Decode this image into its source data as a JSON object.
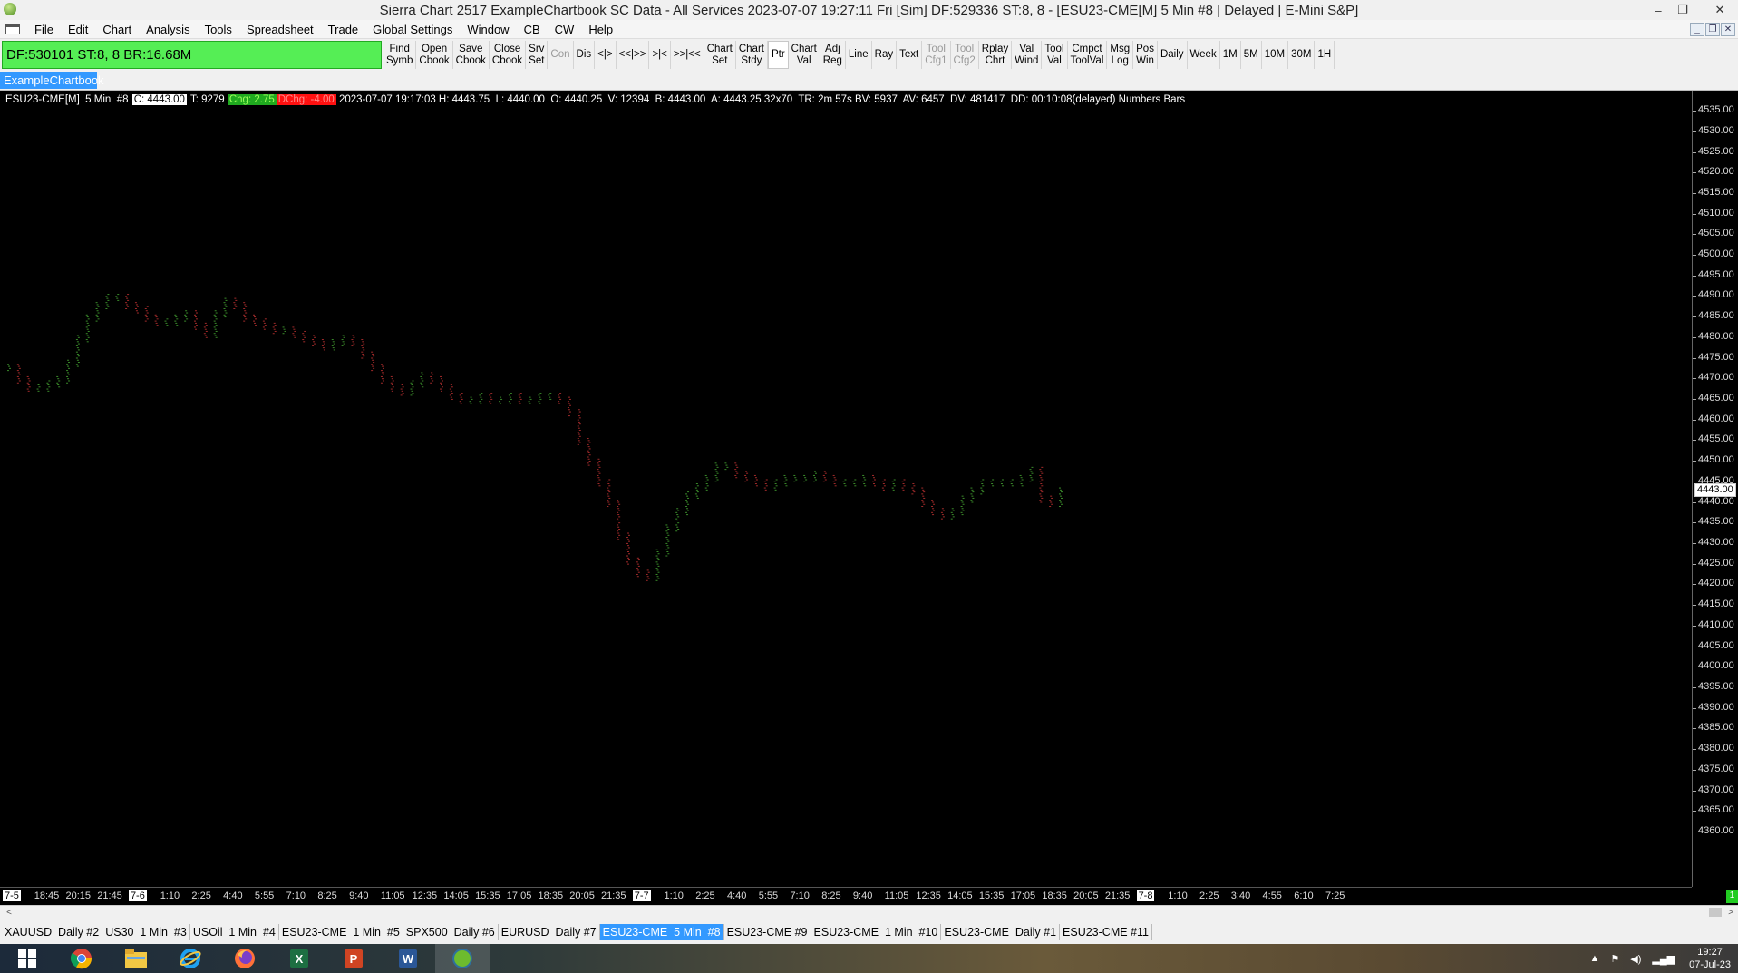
{
  "window": {
    "title": "Sierra Chart 2517 ExampleChartbook SC Data - All Services 2023-07-07  19:27:11 Fri [Sim]  DF:529336  ST:8, 8 - [ESU23-CME[M]  5 Min  #8 | Delayed | E-Mini S&P]",
    "minimize": "–",
    "restore": "❐",
    "close": "✕"
  },
  "menu": [
    "File",
    "Edit",
    "Chart",
    "Analysis",
    "Tools",
    "Spreadsheet",
    "Trade",
    "Global Settings",
    "Window",
    "CB",
    "CW",
    "Help"
  ],
  "mdi_controls": [
    "_",
    "❐",
    "✕"
  ],
  "toolbar": {
    "status": "DF:530101  ST:8, 8  BR:16.68M",
    "buttons": [
      {
        "label": "Find\nSymb",
        "disabled": false
      },
      {
        "label": "Open\nCbook",
        "disabled": false
      },
      {
        "label": "Save\nCbook",
        "disabled": false
      },
      {
        "label": "Close\nCbook",
        "disabled": false
      },
      {
        "label": "Srv\nSet",
        "disabled": false
      },
      {
        "label": "Con",
        "disabled": true
      },
      {
        "label": "Dis",
        "disabled": false
      },
      {
        "label": "<|>",
        "disabled": false
      },
      {
        "label": "<<|>>",
        "disabled": false
      },
      {
        "label": ">|<",
        "disabled": false
      },
      {
        "label": ">>|<<",
        "disabled": false
      },
      {
        "label": "Chart\nSet",
        "disabled": false
      },
      {
        "label": "Chart\nStdy",
        "disabled": false
      },
      {
        "label": "Ptr",
        "disabled": false,
        "active": true
      },
      {
        "label": "Chart\nVal",
        "disabled": false
      },
      {
        "label": "Adj\nReg",
        "disabled": false
      },
      {
        "label": "Line",
        "disabled": false
      },
      {
        "label": "Ray",
        "disabled": false
      },
      {
        "label": "Text",
        "disabled": false
      },
      {
        "label": "Tool\nCfg1",
        "disabled": true
      },
      {
        "label": "Tool\nCfg2",
        "disabled": true
      },
      {
        "label": "Rplay\nChrt",
        "disabled": false
      },
      {
        "label": "Val\nWind",
        "disabled": false
      },
      {
        "label": "Tool\nVal",
        "disabled": false
      },
      {
        "label": "Cmpct\nToolVal",
        "disabled": false
      },
      {
        "label": "Msg\nLog",
        "disabled": false
      },
      {
        "label": "Pos\nWin",
        "disabled": false
      },
      {
        "label": "Daily",
        "disabled": false
      },
      {
        "label": "Week",
        "disabled": false
      },
      {
        "label": "1M",
        "disabled": false
      },
      {
        "label": "5M",
        "disabled": false
      },
      {
        "label": "10M",
        "disabled": false
      },
      {
        "label": "30M",
        "disabled": false
      },
      {
        "label": "1H",
        "disabled": false
      }
    ]
  },
  "chartbook_tab": "ExampleChartbook",
  "chart_header": {
    "symbol": "ESU23-CME[M]  5 Min  #8 ",
    "close": "C: 4443.00",
    "trades": " T: 9279 ",
    "chg": "Chg: 2.75",
    "dchg": "DChg: -4.00",
    "rest": " 2023-07-07 19:17:03 H: 4443.75  L: 4440.00  O: 4440.25  V: 12394  B: 4443.00  A: 4443.25 32x70  TR: 2m 57s BV: 5937  AV: 6457  DV: 481417  DD: 00:10:08(delayed) Numbers Bars"
  },
  "chart_data": {
    "type": "scatter",
    "title": "ESU23-CME[M] 5 Min #8",
    "ylim": [
      4360.0,
      4537.0
    ],
    "y_ticks": [
      "4535.00",
      "4530.00",
      "4525.00",
      "4520.00",
      "4515.00",
      "4510.00",
      "4505.00",
      "4500.00",
      "4495.00",
      "4490.00",
      "4485.00",
      "4480.00",
      "4475.00",
      "4470.00",
      "4465.00",
      "4460.00",
      "4455.00",
      "4450.00",
      "4445.00",
      "4440.00",
      "4435.00",
      "4430.00",
      "4425.00",
      "4420.00",
      "4415.00",
      "4410.00",
      "4405.00",
      "4400.00",
      "4395.00",
      "4390.00",
      "4385.00",
      "4380.00",
      "4375.00",
      "4370.00",
      "4365.00",
      "4360.00"
    ],
    "last_price": "4443.00",
    "x_ticks": [
      {
        "label": "7-5",
        "date": true
      },
      {
        "label": "18:45"
      },
      {
        "label": "20:15"
      },
      {
        "label": "21:45"
      },
      {
        "label": "7-6",
        "date": true
      },
      {
        "label": "1:10"
      },
      {
        "label": "2:25"
      },
      {
        "label": "4:40"
      },
      {
        "label": "5:55"
      },
      {
        "label": "7:10"
      },
      {
        "label": "8:25"
      },
      {
        "label": "9:40"
      },
      {
        "label": "11:05"
      },
      {
        "label": "12:35"
      },
      {
        "label": "14:05"
      },
      {
        "label": "15:35"
      },
      {
        "label": "17:05"
      },
      {
        "label": "18:35"
      },
      {
        "label": "20:05"
      },
      {
        "label": "21:35"
      },
      {
        "label": "7-7",
        "date": true
      },
      {
        "label": "1:10"
      },
      {
        "label": "2:25"
      },
      {
        "label": "4:40"
      },
      {
        "label": "5:55"
      },
      {
        "label": "7:10"
      },
      {
        "label": "8:25"
      },
      {
        "label": "9:40"
      },
      {
        "label": "11:05"
      },
      {
        "label": "12:35"
      },
      {
        "label": "14:05"
      },
      {
        "label": "15:35"
      },
      {
        "label": "17:05"
      },
      {
        "label": "18:35"
      },
      {
        "label": "20:05"
      },
      {
        "label": "21:35"
      },
      {
        "label": "7-8",
        "date": true
      },
      {
        "label": "1:10"
      },
      {
        "label": "2:25"
      },
      {
        "label": "3:40"
      },
      {
        "label": "4:55"
      },
      {
        "label": "6:10"
      },
      {
        "label": "7:25"
      }
    ],
    "series": [
      {
        "values": [
          4473,
          4470,
          4468,
          4468,
          4469,
          4470,
          4474,
          4480,
          4485,
          4488,
          4490,
          4490,
          4488,
          4487,
          4485,
          4484,
          4484,
          4485,
          4486,
          4483,
          4481,
          4486,
          4489,
          4488,
          4485,
          4484,
          4483,
          4482,
          4482,
          4481,
          4480,
          4479,
          4478,
          4479,
          4480,
          4479,
          4476,
          4473,
          4470,
          4468,
          4467,
          4469,
          4471,
          4470,
          4468,
          4466,
          4465,
          4465,
          4466,
          4465,
          4465,
          4466,
          4465,
          4465,
          4466,
          4466,
          4465,
          4462,
          4455,
          4450,
          4445,
          4440,
          4432,
          4426,
          4423,
          4422,
          4428,
          4434,
          4438,
          4442,
          4444,
          4446,
          4449,
          4449,
          4447,
          4446,
          4445,
          4444,
          4445,
          4446,
          4446,
          4446,
          4447,
          4446,
          4445,
          4445,
          4445,
          4446,
          4445,
          4444,
          4445,
          4444,
          4443,
          4440,
          4438,
          4437,
          4438,
          4441,
          4443,
          4445,
          4445,
          4445,
          4445,
          4446,
          4448,
          4441,
          4440,
          4443
        ],
        "colors": "mixed-red-green-numbers"
      }
    ]
  },
  "chart_tabs": [
    {
      "label": "XAUUSD  Daily #2"
    },
    {
      "label": "US30  1 Min  #3"
    },
    {
      "label": "USOil  1 Min  #4"
    },
    {
      "label": "ESU23-CME  1 Min  #5"
    },
    {
      "label": "SPX500  Daily #6"
    },
    {
      "label": "EURUSD  Daily #7"
    },
    {
      "label": "ESU23-CME  5 Min  #8",
      "active": true
    },
    {
      "label": "ESU23-CME #9"
    },
    {
      "label": "ESU23-CME  1 Min  #10"
    },
    {
      "label": "ESU23-CME  Daily #1"
    },
    {
      "label": "ESU23-CME #11"
    }
  ],
  "scroll_left": "<",
  "scroll_right": ">",
  "green_indicator": "1",
  "taskbar": {
    "apps": [
      "windows-start-icon",
      "chrome-icon",
      "file-explorer-icon",
      "internet-explorer-icon",
      "firefox-icon",
      "excel-icon",
      "powerpoint-icon",
      "word-icon",
      "sierra-chart-icon"
    ],
    "time": "19:27",
    "date": "07-Jul-23"
  }
}
